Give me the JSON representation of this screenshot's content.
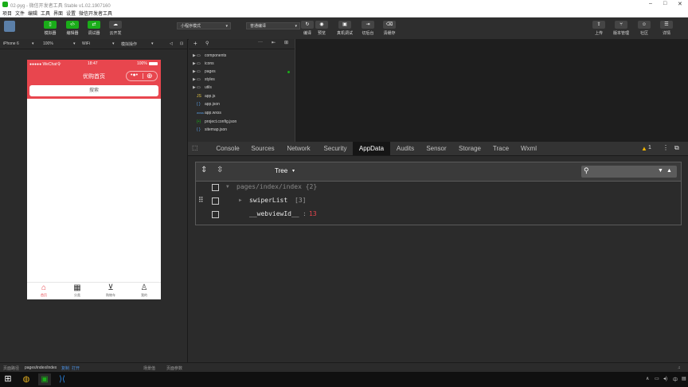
{
  "window": {
    "title": "02-pyg - 微信开发者工具 Stable v1.02.1907160"
  },
  "menu": [
    "项目",
    "文件",
    "编辑",
    "工具",
    "界面",
    "设置",
    "微信开发者工具"
  ],
  "toolbar": {
    "left_buttons": [
      {
        "label": "模拟器",
        "icon": "phone-icon"
      },
      {
        "label": "编辑器",
        "icon": "code-icon"
      },
      {
        "label": "调试器",
        "icon": "debug-icon"
      },
      {
        "label": "云开发",
        "icon": "cloud-icon"
      }
    ],
    "mode_select": "小程序模式",
    "compile_select": "普通编译",
    "mid_buttons": [
      {
        "label": "编译",
        "icon": "refresh-icon"
      },
      {
        "label": "预览",
        "icon": "eye-icon"
      },
      {
        "label": "真机调试",
        "icon": "remote-debug-icon"
      },
      {
        "label": "切后台",
        "icon": "switch-icon"
      },
      {
        "label": "清缓存",
        "icon": "clear-cache-icon"
      }
    ],
    "right_buttons": [
      {
        "label": "上传",
        "icon": "upload-icon"
      },
      {
        "label": "版本管理",
        "icon": "version-icon"
      },
      {
        "label": "社区",
        "icon": "community-icon"
      },
      {
        "label": "详情",
        "icon": "details-icon"
      }
    ]
  },
  "simulator": {
    "device": "iPhone 6",
    "zoom": "100%",
    "network": "WiFi",
    "action": "模拟操作",
    "status_carrier": "●●●●● WeChat令",
    "status_time": "18:47",
    "status_battery": "100%",
    "nav_title": "优购首页",
    "search_label": "搜索",
    "tabs": [
      {
        "label": "首页",
        "icon": "home-icon",
        "glyph": "⌂"
      },
      {
        "label": "分类",
        "icon": "category-icon",
        "glyph": "▦"
      },
      {
        "label": "购物车",
        "icon": "cart-icon",
        "glyph": "⊻"
      },
      {
        "label": "我的",
        "icon": "user-icon",
        "glyph": "♙"
      }
    ]
  },
  "filetree": {
    "items": [
      {
        "name": "components",
        "type": "folder"
      },
      {
        "name": "icons",
        "type": "folder"
      },
      {
        "name": "pages",
        "type": "folder"
      },
      {
        "name": "styles",
        "type": "folder"
      },
      {
        "name": "utils",
        "type": "folder"
      },
      {
        "name": "app.js",
        "type": "js",
        "tag": "JS"
      },
      {
        "name": "app.json",
        "type": "json",
        "tag": "{ }"
      },
      {
        "name": "app.wxss",
        "type": "wxss",
        "tag": "wxss"
      },
      {
        "name": "project.config.json",
        "type": "config",
        "tag": "{•}"
      },
      {
        "name": "sitemap.json",
        "type": "json",
        "tag": "{ }"
      }
    ]
  },
  "devtools": {
    "tabs": [
      "Console",
      "Sources",
      "Network",
      "Security",
      "AppData",
      "Audits",
      "Sensor",
      "Storage",
      "Trace",
      "Wxml"
    ],
    "active_tab": "AppData",
    "warning_count": "1",
    "view_mode": "Tree",
    "tree": {
      "root": "pages/index/index {2}",
      "swiper_key": "swiperList",
      "swiper_count": "[3]",
      "webview_key": "__webviewId__",
      "webview_sep": ":",
      "webview_value": "13"
    }
  },
  "statusbar": {
    "path_label": "页面路径",
    "path_value": "pages/index/index",
    "copy": "复制",
    "open": "打开",
    "scene": "场景值",
    "params": "页面参数"
  },
  "colors": {
    "accent_red": "#e8464e",
    "wechat_green": "#1aad19",
    "value_red": "#e8464e"
  }
}
